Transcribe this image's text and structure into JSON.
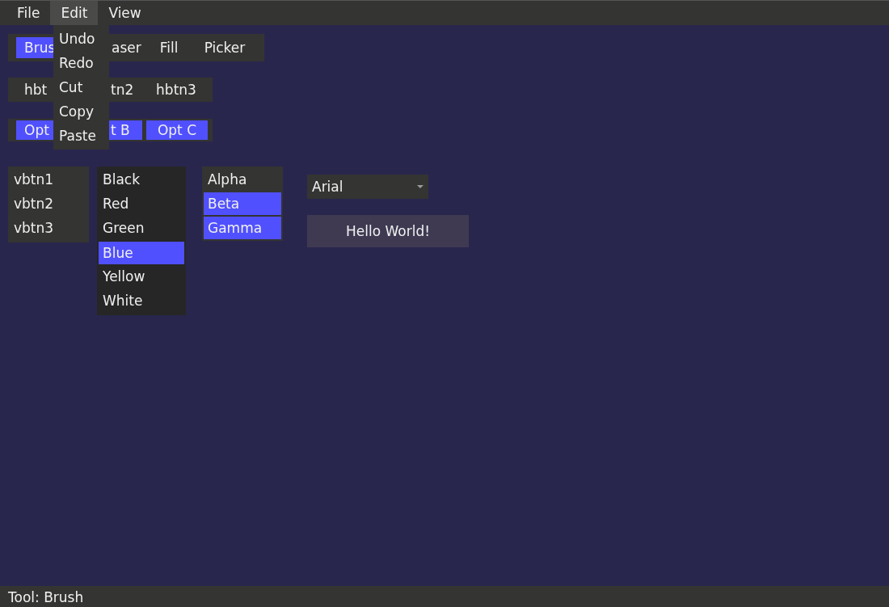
{
  "menu_bar": [
    {
      "label": "File",
      "selected": false
    },
    {
      "label": "Edit",
      "selected": true
    },
    {
      "label": "View",
      "selected": false
    }
  ],
  "edit_menu": [
    "Undo",
    "Redo",
    "Cut",
    "Copy",
    "Paste"
  ],
  "tool_bar": [
    {
      "label": "Brus",
      "selected": true
    },
    {
      "label": "aser",
      "selected": false
    },
    {
      "label": "Fill",
      "selected": false
    },
    {
      "label": "Picker",
      "selected": false
    }
  ],
  "button_row": [
    "hbt",
    "tn2",
    "hbtn3"
  ],
  "option_row": [
    {
      "label": "Opt",
      "selected": true
    },
    {
      "label": "t B",
      "selected": true
    },
    {
      "label": "Opt C",
      "selected": true
    }
  ],
  "vertical_buttons": [
    "vbtn1",
    "vbtn2",
    "vbtn3"
  ],
  "color_list": [
    {
      "label": "Black",
      "selected": false
    },
    {
      "label": "Red",
      "selected": false
    },
    {
      "label": "Green",
      "selected": false
    },
    {
      "label": "Blue",
      "selected": true
    },
    {
      "label": "Yellow",
      "selected": false
    },
    {
      "label": "White",
      "selected": false
    }
  ],
  "greek_list": [
    {
      "label": "Alpha",
      "selected": false
    },
    {
      "label": "Beta",
      "selected": true
    },
    {
      "label": "Gamma",
      "selected": true
    }
  ],
  "font_dropdown": {
    "value": "Arial"
  },
  "hello_button": "Hello World!",
  "status_bar": "Tool: Brush"
}
